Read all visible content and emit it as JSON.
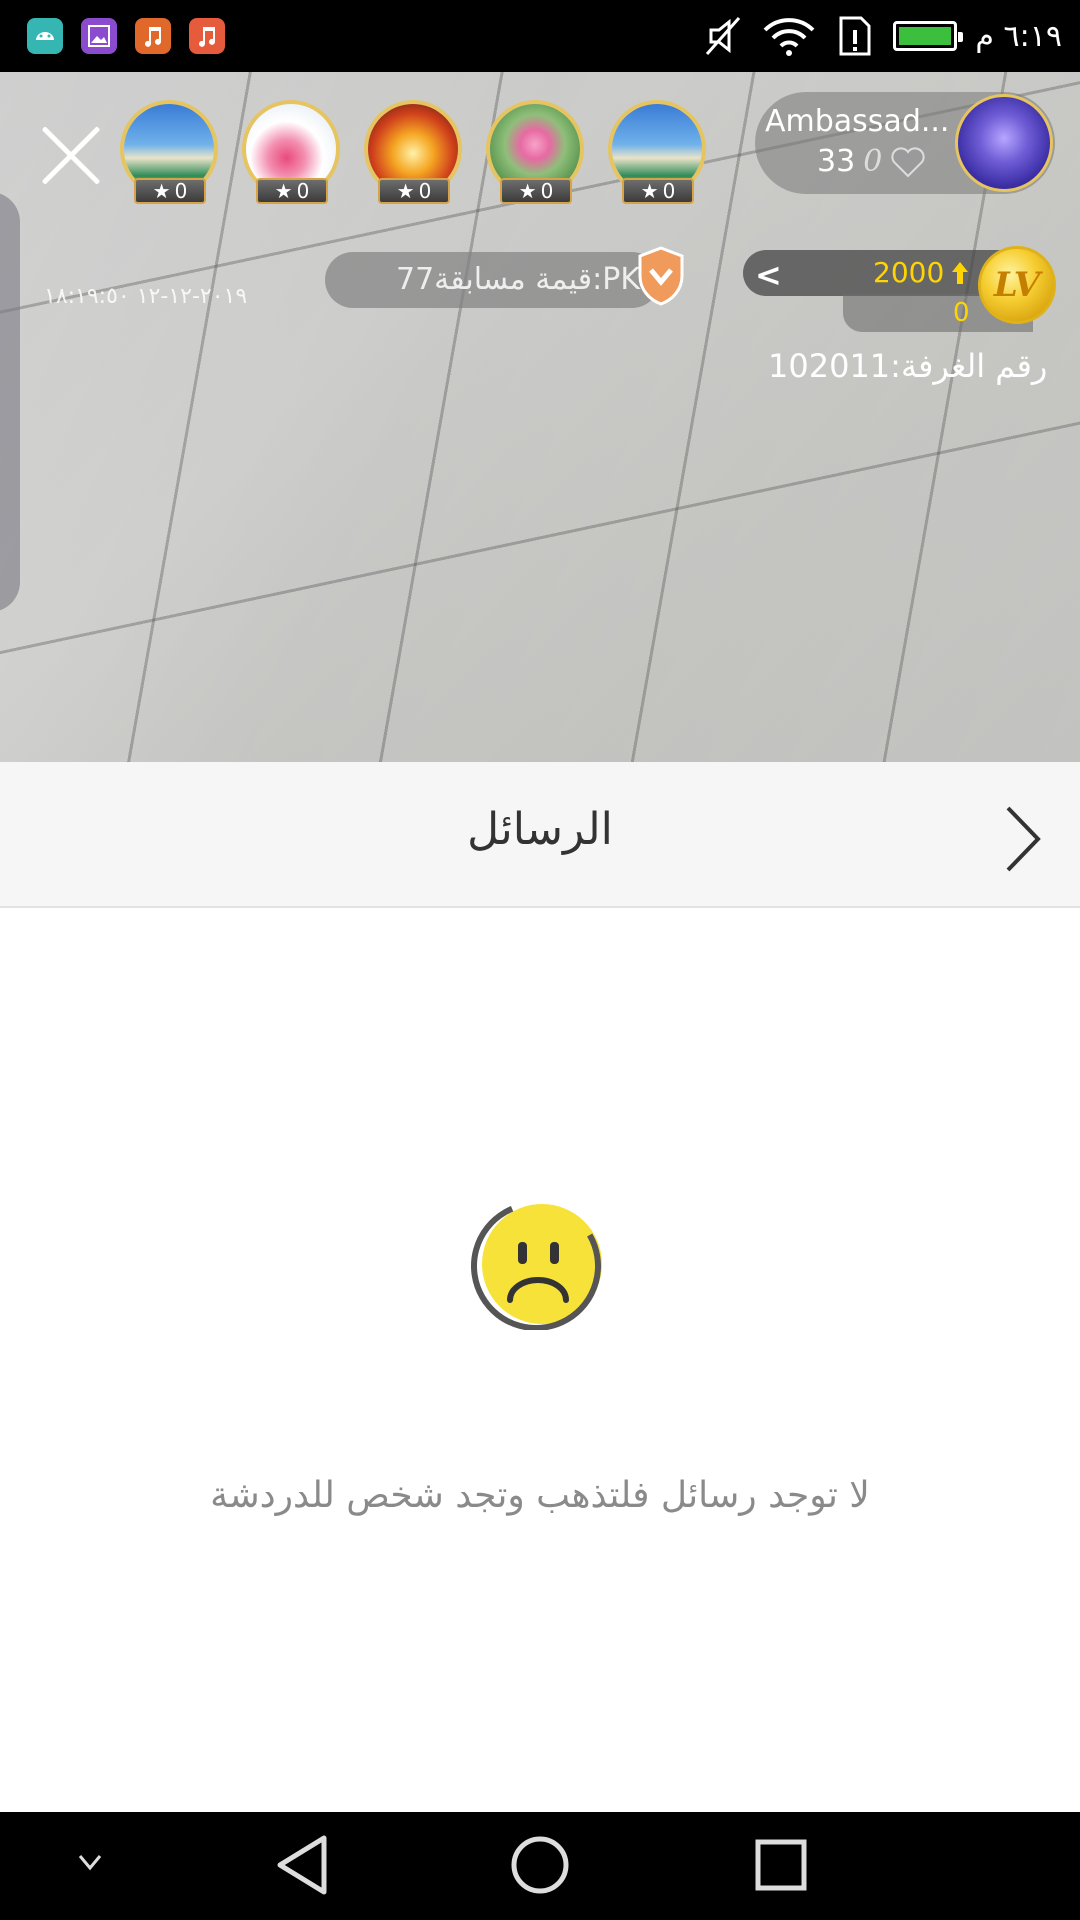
{
  "status_bar": {
    "time": "٦:١٩ م",
    "apps": [
      {
        "icon": "android-icon",
        "color": "#35b6b3"
      },
      {
        "icon": "gallery-icon",
        "color": "#8b4bcf"
      },
      {
        "icon": "music-icon",
        "color": "#e0682b"
      },
      {
        "icon": "music-icon",
        "color": "#e55b3b"
      }
    ]
  },
  "live": {
    "viewers": [
      {
        "count": "0",
        "image": "beach"
      },
      {
        "count": "0",
        "image": "flowers"
      },
      {
        "count": "0",
        "image": "fire"
      },
      {
        "count": "0",
        "image": "lotus"
      },
      {
        "count": "0",
        "image": "beach"
      }
    ],
    "host": {
      "name": "Ambassad...",
      "count": "33",
      "likes": "0"
    },
    "pk_label": "قيمة مسابقة77:PK",
    "timestamp": "٢٠١٩-١٢-١٢ ١٨:١٩:٥٠",
    "coins": "2000",
    "coins_sub": "0",
    "level_label": "LV",
    "room_number": "رقم الغرفة:102011"
  },
  "messages": {
    "title": "الرسائل",
    "empty_text": "لا توجد رسائل فلتذهب وتجد شخص للدردشة"
  },
  "colors": {
    "accent_gold": "#e6c45f",
    "coin_yellow": "#ffd400",
    "empty_face": "#f7e23a"
  }
}
